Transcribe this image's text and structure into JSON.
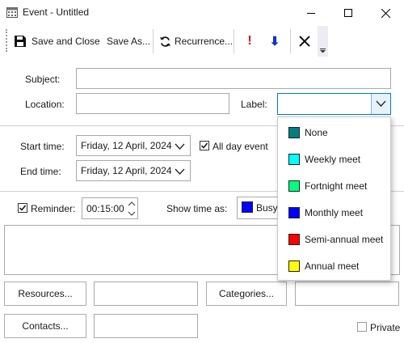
{
  "window": {
    "title": "Event - Untitled"
  },
  "toolbar": {
    "save_close": "Save and Close",
    "save_as": "Save As...",
    "recurrence": "Recurrence...",
    "high_importance": "!",
    "low_importance": "⬇"
  },
  "form": {
    "subject_label": "Subject:",
    "subject_value": "",
    "location_label": "Location:",
    "location_value": "",
    "label_label": "Label:",
    "label_value": "",
    "start_label": "Start time:",
    "start_date": "Friday, 12 April, 2024",
    "end_label": "End time:",
    "end_date": "Friday, 12 April, 2024",
    "all_day_label": "All day event",
    "all_day_checked": true,
    "reminder_label": "Reminder:",
    "reminder_checked": true,
    "reminder_value": "00:15:00",
    "show_time_as_label": "Show time as:",
    "show_time_as_value": "Busy",
    "show_time_as_color": "#0000ff",
    "resources_button": "Resources...",
    "categories_button": "Categories...",
    "contacts_button": "Contacts...",
    "private_label": "Private",
    "private_checked": false
  },
  "label_dropdown": {
    "items": [
      {
        "label": "None",
        "color": "#008080"
      },
      {
        "label": "Weekly meet",
        "color": "#00ffff"
      },
      {
        "label": "Fortnight meet",
        "color": "#00ff80"
      },
      {
        "label": "Monthly meet",
        "color": "#0000ff"
      },
      {
        "label": "Semi-annual meet",
        "color": "#ff0000"
      },
      {
        "label": "Annual meet",
        "color": "#ffff00"
      }
    ]
  }
}
